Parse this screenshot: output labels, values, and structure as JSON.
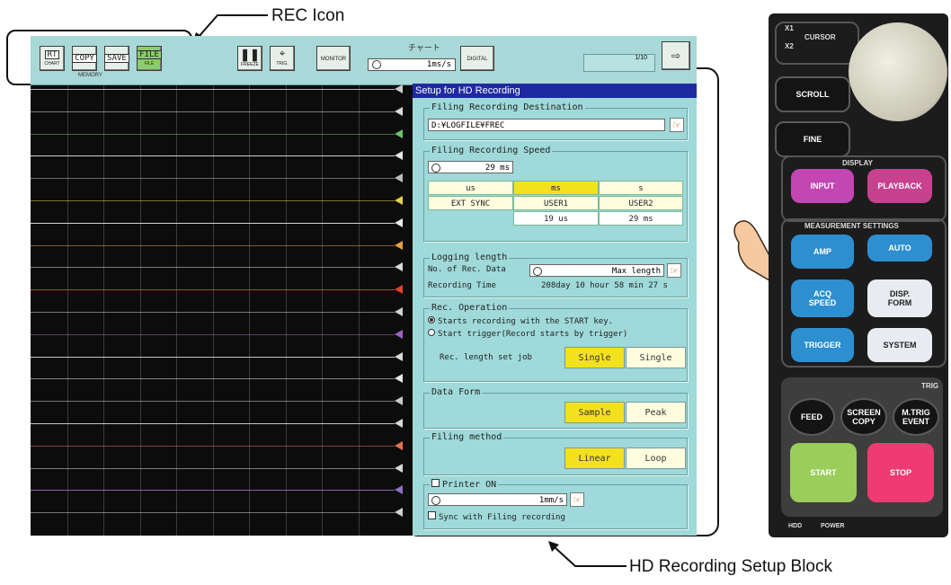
{
  "callouts": {
    "rec_icon": "REC Icon",
    "hd_block": "HD Recording Setup Block"
  },
  "toolbar": {
    "buttons": [
      {
        "label": "RT",
        "sub": "CHART"
      },
      {
        "label": "COPY",
        "sub": ""
      },
      {
        "label": "SAVE",
        "sub": ""
      },
      {
        "label": "FILE",
        "sub": "FILE"
      },
      {
        "label": "FREEZE",
        "sub": ""
      },
      {
        "label": "TRIG.",
        "sub": ""
      },
      {
        "label": "MONITOR",
        "sub": ""
      },
      {
        "label": "DIGITAL",
        "sub": ""
      }
    ],
    "memory_label": "MEMORY",
    "chart_title": "チャート",
    "speed": "1ms/s",
    "page": "1/10"
  },
  "dialog": {
    "title": "Setup for HD Recording",
    "dest_title": "Filing Recording Destination",
    "dest_path": "D:¥LOGFILE¥FREC",
    "speed_title": "Filing Recording Speed",
    "speed_value": "29 ms",
    "units": [
      "us",
      "ms",
      "s"
    ],
    "selected_unit": "ms",
    "row2": [
      "EXT SYNC",
      "USER1",
      "USER2"
    ],
    "user_values": [
      "19 us",
      "29 ms"
    ],
    "logging_title": "Logging length",
    "rec_data_label": "No. of Rec. Data",
    "rec_data_value": "Max length",
    "rec_time_label": "Recording Time",
    "rec_time_value": "208day 10 hour 58 min 27 s",
    "rec_op_title": "Rec. Operation",
    "rec_op_option1": "Starts recording with the START key.",
    "rec_op_option2": "Start trigger(Record starts by trigger)",
    "rec_length_label": "Rec. length set job",
    "rec_length_opts": [
      "Single",
      "Single"
    ],
    "data_form_title": "Data Form",
    "data_form_opts": [
      "Sample",
      "Peak"
    ],
    "filing_method_title": "Filing method",
    "filing_method_opts": [
      "Linear",
      "Loop"
    ],
    "printer_label": "Printer ON",
    "printer_speed": "1mm/s",
    "sync_label": "Sync with Filing recording"
  },
  "panel": {
    "cursor": "CURSOR",
    "x1": "X1",
    "x2": "X2",
    "scroll": "SCROLL",
    "fine": "FINE",
    "display": "DISPLAY",
    "input": "INPUT",
    "playback": "PLAYBACK",
    "measurement": "MEASUREMENT SETTINGS",
    "amp": "AMP",
    "auto": "AUTO",
    "acq1": "ACQ",
    "acq2": "SPEED",
    "disp1": "DISP.",
    "disp2": "FORM",
    "trigger": "TRIGGER",
    "system": "SYSTEM",
    "trig": "TRIG",
    "feed": "FEED",
    "screen1": "SCREEN",
    "screen2": "COPY",
    "mtrig1": "M.TRIG",
    "mtrig2": "EVENT",
    "start": "START",
    "stop": "STOP",
    "hdd": "HDD",
    "power": "POWER"
  },
  "colors": {
    "trace_colors": [
      "#c9c9c9",
      "#d9d9d9",
      "#6cc06a",
      "#e6e6e6",
      "#bcbcbc",
      "#e0d050",
      "#e8e8e8",
      "#e8a040",
      "#d8d8d8",
      "#e04030",
      "#d0d0d0",
      "#a060c0",
      "#d8d8d8",
      "#e8e8e8",
      "#c8c8c8",
      "#d8d8d8",
      "#e87050",
      "#d8d8d8",
      "#9070c0",
      "#d0d0d0"
    ]
  }
}
